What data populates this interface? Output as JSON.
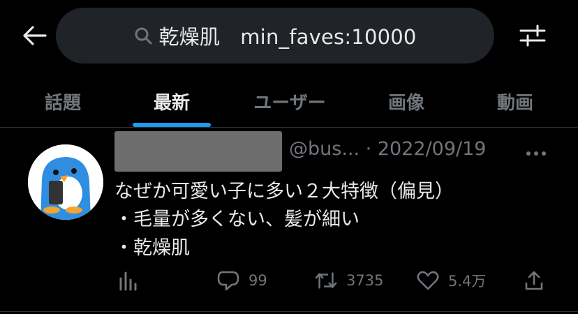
{
  "search": {
    "query": "乾燥肌　min_faves:10000"
  },
  "tabs": [
    {
      "label": "話題"
    },
    {
      "label": "最新"
    },
    {
      "label": "ユーザー"
    },
    {
      "label": "画像"
    },
    {
      "label": "動画"
    }
  ],
  "active_tab": "最新",
  "tweet": {
    "handle": "@bus...",
    "separator": "·",
    "date": "2022/09/19",
    "lines": [
      "なぜか可愛い子に多い２大特徴（偏見）",
      "・毛量が多くない、髪が細い",
      "・乾燥肌"
    ],
    "replies": "99",
    "retweets": "3735",
    "likes": "5.4万"
  },
  "colors": {
    "background": "#000000",
    "search_bg": "#202327",
    "accent": "#1d9bf0",
    "text_primary": "#e7e9ea",
    "text_secondary": "#71767b"
  }
}
